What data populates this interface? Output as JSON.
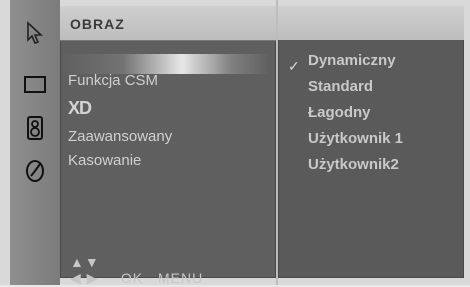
{
  "menu": {
    "title": "OBRAZ",
    "items": [
      {
        "label": "Funkcja CSM"
      },
      {
        "label": "XD"
      },
      {
        "label": "Zaawansowany"
      },
      {
        "label": "Kasowanie"
      }
    ],
    "hint": {
      "arrows": "▲▼ ◀ ▶",
      "ok": "OK",
      "menu": "MENU"
    }
  },
  "submenu": {
    "items": [
      {
        "label": "Dynamiczny",
        "selected": true
      },
      {
        "label": "Standard"
      },
      {
        "label": "Łagodny"
      },
      {
        "label": "Użytkownik 1"
      },
      {
        "label": "Użytkownik2"
      }
    ]
  },
  "icons": {
    "rail": [
      "cursor-icon",
      "screen-icon",
      "speaker-icon",
      "clock-icon"
    ]
  }
}
